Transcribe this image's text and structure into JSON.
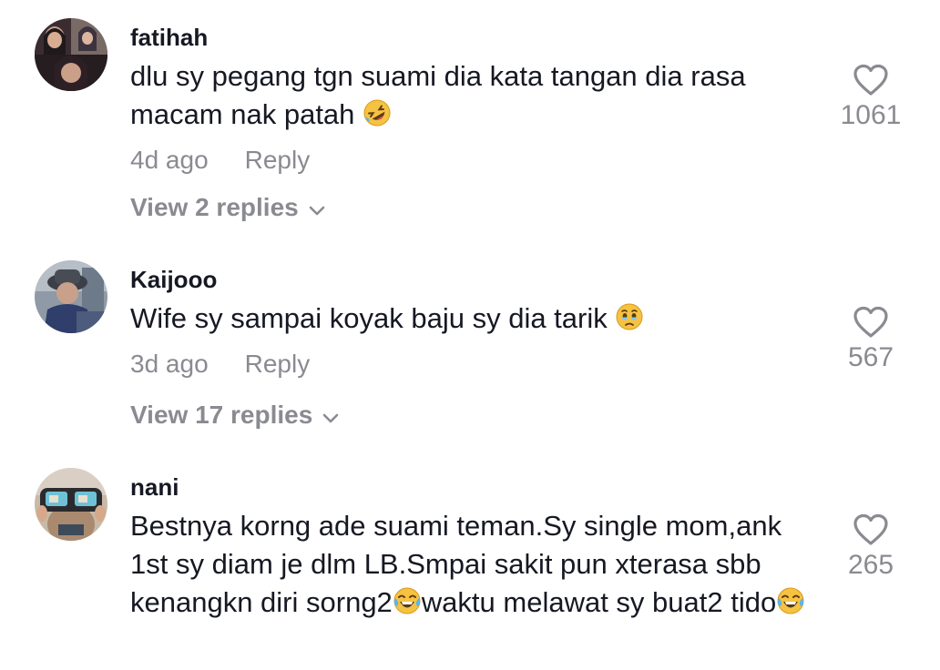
{
  "comments": [
    {
      "username": "fatihah",
      "text": "dlu sy pegang tgn suami dia kata tangan dia rasa macam nak patah",
      "emoji": "rolling-on-floor-laughing-emoji",
      "time": "4d ago",
      "reply_label": "Reply",
      "view_replies": "View 2 replies",
      "likes": "1061"
    },
    {
      "username": "Kaijooo",
      "text": "Wife sy sampai koyak baju sy dia tarik",
      "emoji": "holding-back-tears-emoji",
      "time": "3d ago",
      "reply_label": "Reply",
      "view_replies": "View 17 replies",
      "likes": "567"
    },
    {
      "username": "nani",
      "text_part1": "Bestnya korng ade suami teman.Sy single mom,ank 1st sy diam je dlm LB.Smpai sakit pun xterasa sbb kenangkn diri sorng2",
      "text_part2": "waktu melawat sy buat2 tido",
      "emoji": "tears-of-joy-emoji",
      "likes": "265"
    }
  ],
  "colors": {
    "text_primary": "#161823",
    "text_secondary": "#8a8b91",
    "emoji_yellow": "#f5c242"
  }
}
